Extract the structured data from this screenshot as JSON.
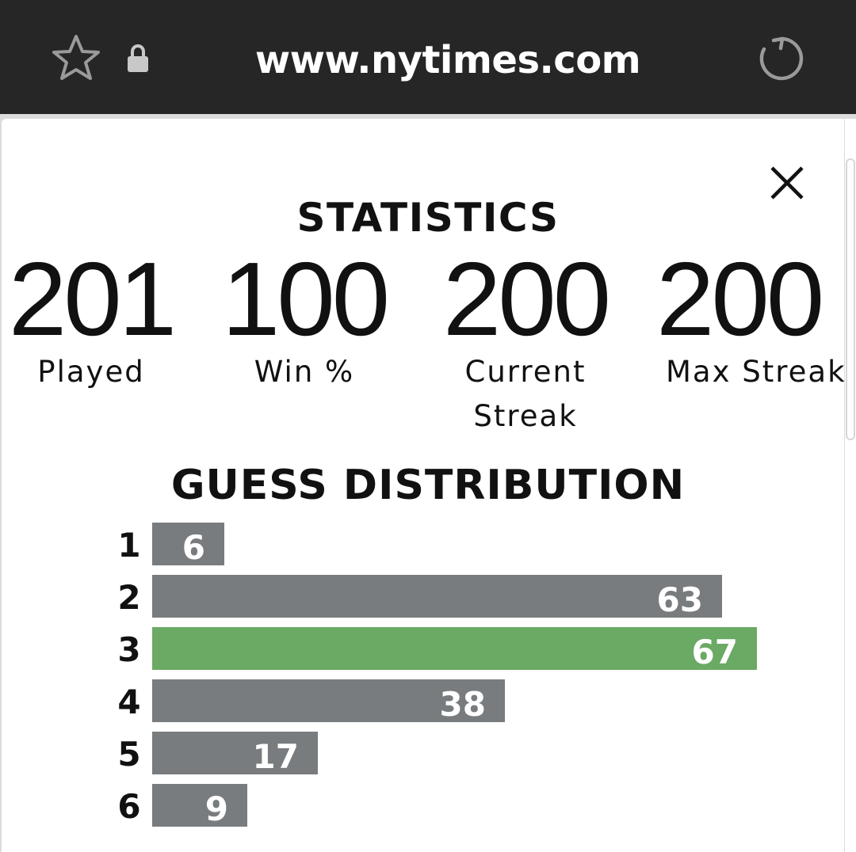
{
  "browser": {
    "url": "www.nytimes.com",
    "icons": [
      "star-icon",
      "lock-icon",
      "reload-icon"
    ]
  },
  "modal": {
    "close_icon": "close-icon",
    "statistics_title": "STATISTICS",
    "stats": [
      {
        "value": "201",
        "label": "Played"
      },
      {
        "value": "100",
        "label": "Win %"
      },
      {
        "value": "200",
        "label": "Current Streak"
      },
      {
        "value": "200",
        "label": "Max Streak"
      }
    ],
    "guess_title": "GUESS DISTRIBUTION",
    "guesses": [
      {
        "guess": "1",
        "count": "6",
        "highlighted": false
      },
      {
        "guess": "2",
        "count": "63",
        "highlighted": false
      },
      {
        "guess": "3",
        "count": "67",
        "highlighted": true
      },
      {
        "guess": "4",
        "count": "38",
        "highlighted": false
      },
      {
        "guess": "5",
        "count": "17",
        "highlighted": false
      },
      {
        "guess": "6",
        "count": "9",
        "highlighted": false
      }
    ]
  },
  "colors": {
    "bar_default": "#787c7e",
    "bar_highlight": "#6aaa64",
    "browser_bar": "#262626"
  }
}
